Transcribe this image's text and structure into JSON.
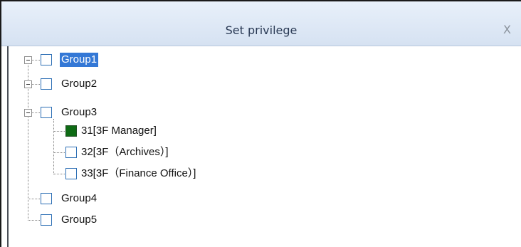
{
  "window": {
    "title": "Set privilege",
    "close_glyph": "X"
  },
  "tree": {
    "group1": {
      "label": "Group1",
      "checked": false,
      "selected": true
    },
    "group2": {
      "label": "Group2",
      "checked": false
    },
    "group3": {
      "label": "Group3",
      "checked": false,
      "children": [
        {
          "label": "31[3F Manager]",
          "checked": true
        },
        {
          "label": "32[3F（Archives）]",
          "checked": false
        },
        {
          "label": "33[3F（Finance Office）]",
          "checked": false
        }
      ]
    },
    "group4": {
      "label": "Group4",
      "checked": false
    },
    "group5": {
      "label": "Group5",
      "checked": false
    }
  },
  "colors": {
    "checked_fill": "#0e6b14",
    "selection_bg": "#3478d6",
    "checkbox_border": "#2d6fb5"
  }
}
